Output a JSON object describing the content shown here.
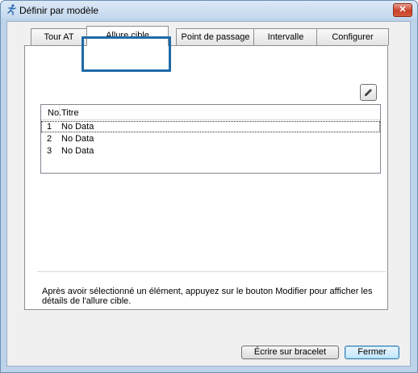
{
  "window": {
    "title": "Définir par modèle",
    "close_glyph": "✕"
  },
  "tabs": [
    {
      "label": "Tour AT"
    },
    {
      "label": "Allure cible"
    },
    {
      "label": "Point de passage"
    },
    {
      "label": "Intervalle"
    },
    {
      "label": "Configurer"
    }
  ],
  "active_tab": "Allure cible",
  "list": {
    "headers": {
      "no": "No.",
      "title": "Titre"
    },
    "rows": [
      {
        "no": "1",
        "title": "No Data"
      },
      {
        "no": "2",
        "title": "No Data"
      },
      {
        "no": "3",
        "title": "No Data"
      }
    ]
  },
  "info_text": "Après avoir sélectionné un élément, appuyez sur le bouton Modifier pour afficher les détails de l'allure cible.",
  "buttons": {
    "write": "Écrire sur bracelet",
    "close": "Fermer"
  },
  "icons": {
    "app": "runner-icon",
    "edit": "pencil-icon"
  },
  "colors": {
    "highlight": "#1e6aa7",
    "titlebar": "#c4d8ee"
  }
}
